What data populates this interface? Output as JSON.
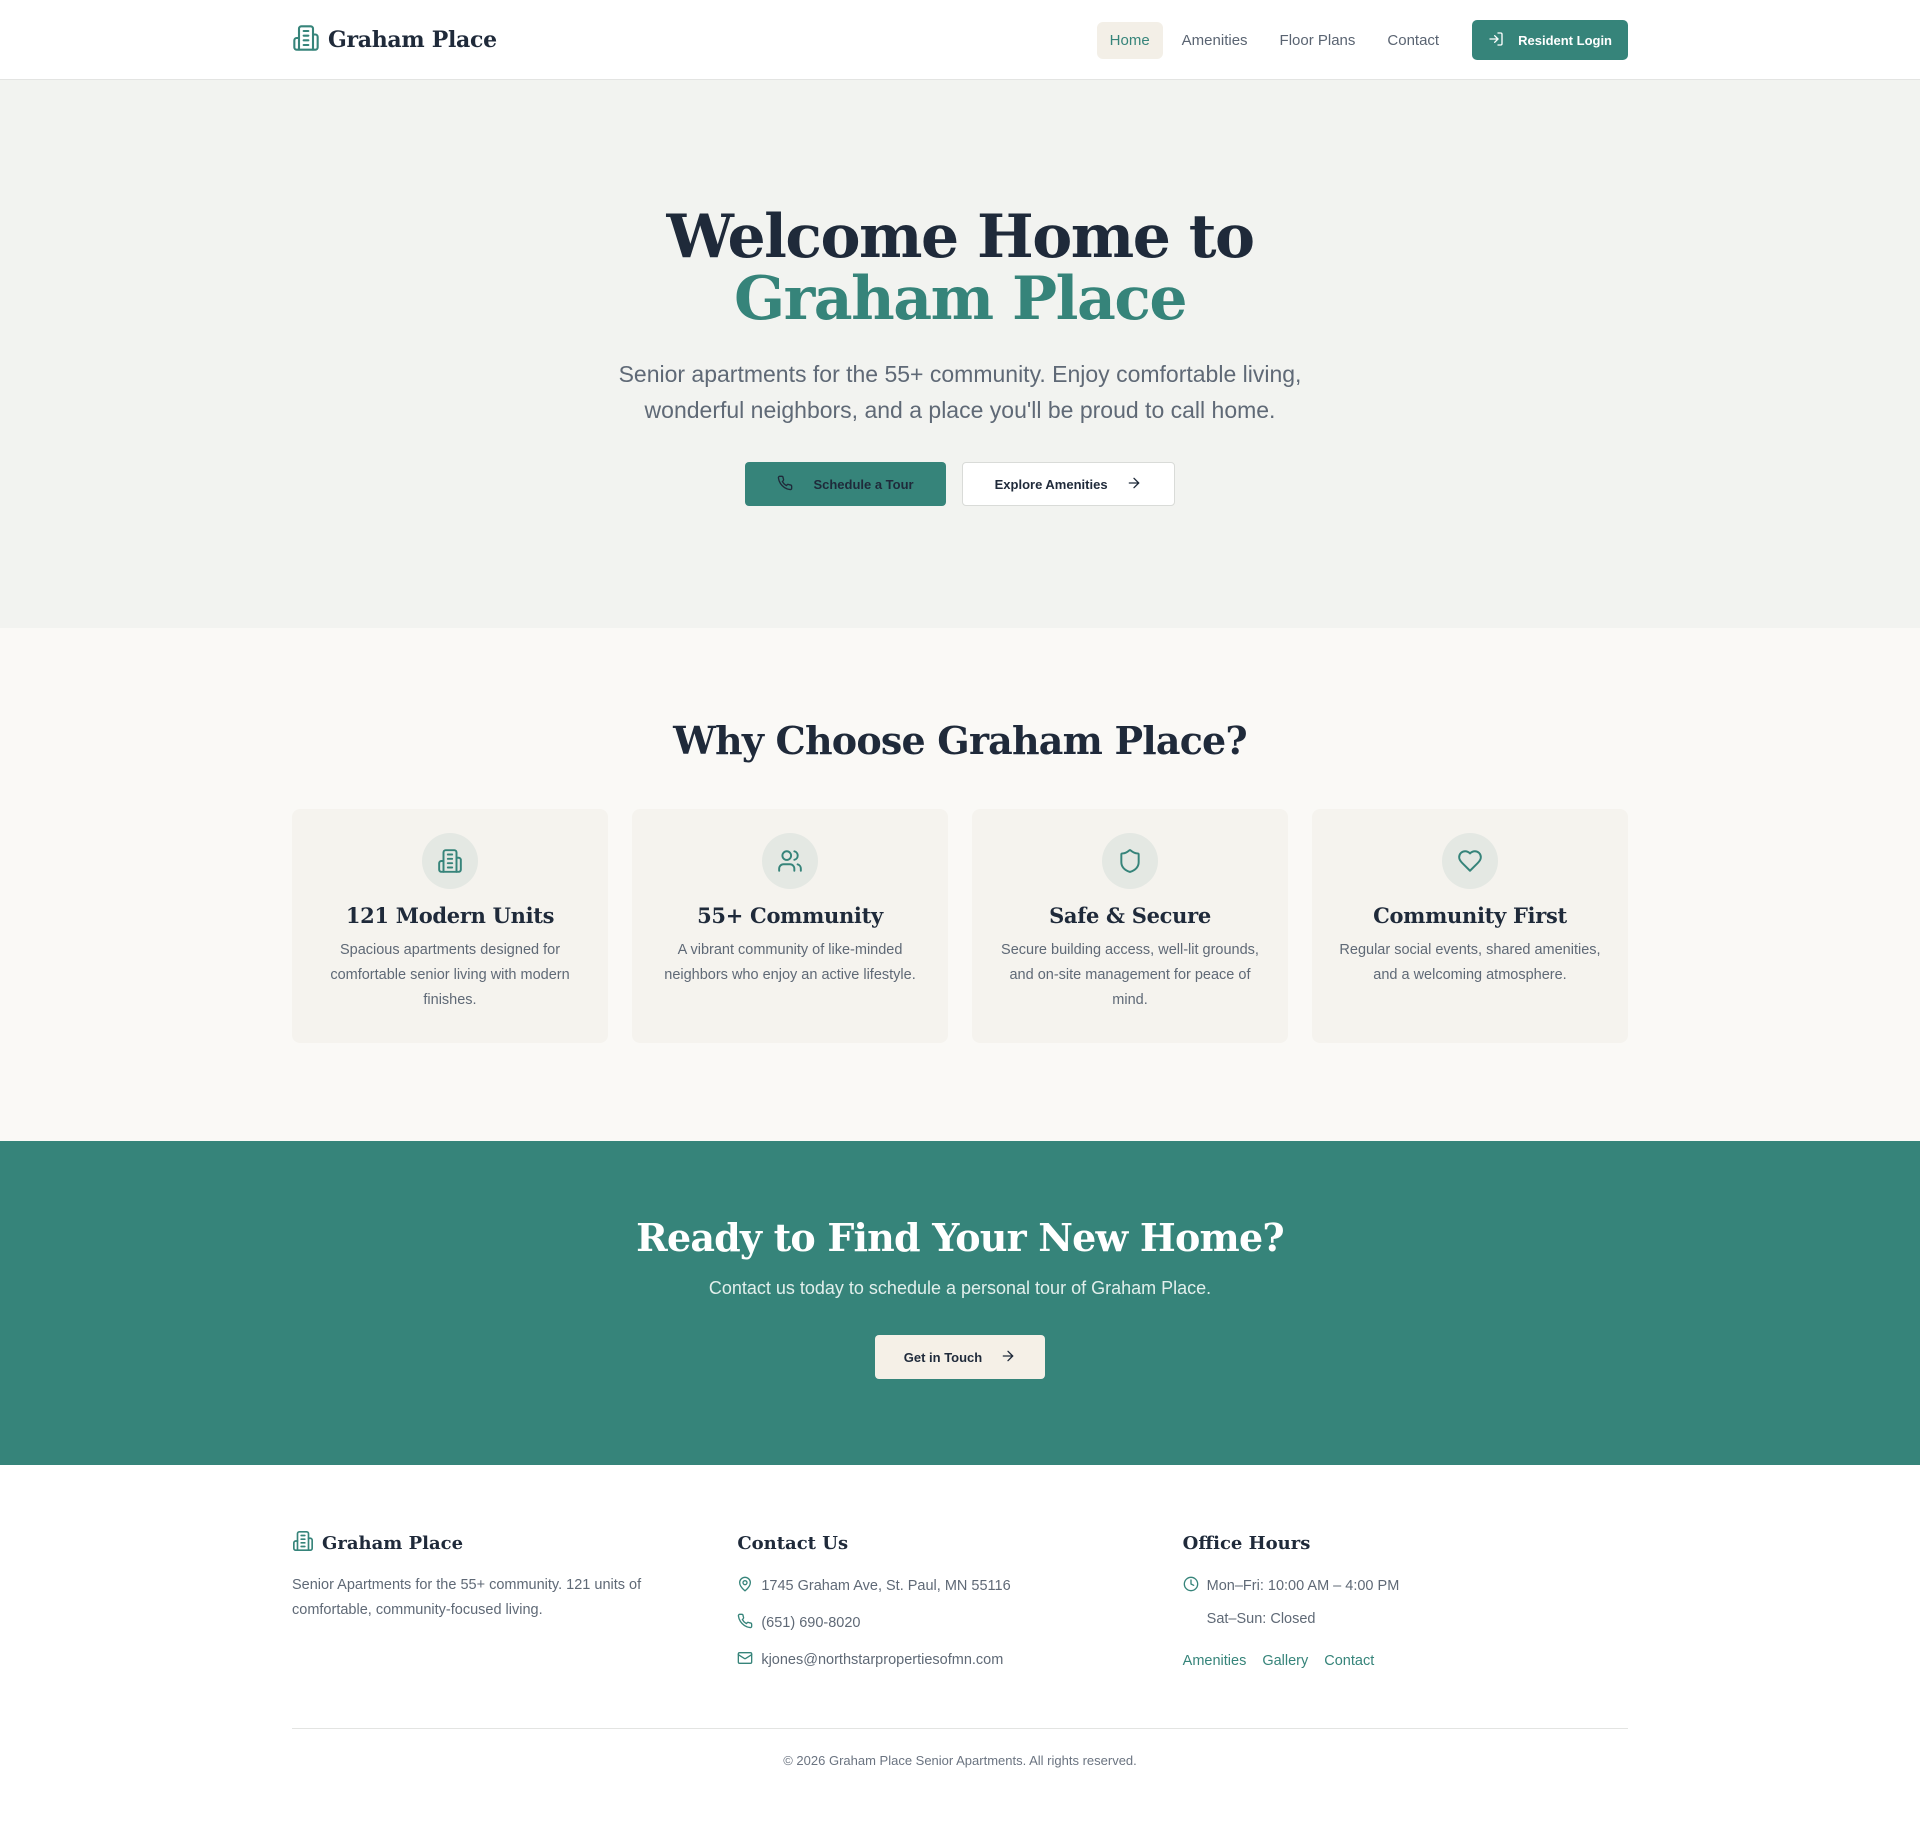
{
  "header": {
    "brand_name": "Graham Place",
    "nav": [
      {
        "label": "Home",
        "active": true
      },
      {
        "label": "Amenities",
        "active": false
      },
      {
        "label": "Floor Plans",
        "active": false
      },
      {
        "label": "Contact",
        "active": false
      }
    ],
    "login_label": "Resident Login"
  },
  "hero": {
    "title_line1": "Welcome Home to",
    "title_line2": "Graham Place",
    "subtitle": "Senior apartments for the 55+ community. Enjoy comfortable living, wonderful neighbors, and a place you'll be proud to call home.",
    "primary_cta": "Schedule a Tour",
    "secondary_cta": "Explore Amenities"
  },
  "features": {
    "title": "Why Choose Graham Place?",
    "cards": [
      {
        "icon": "building-icon",
        "title": "121 Modern Units",
        "desc": "Spacious apartments designed for comfortable senior living with modern finishes."
      },
      {
        "icon": "users-icon",
        "title": "55+ Community",
        "desc": "A vibrant community of like-minded neighbors who enjoy an active lifestyle."
      },
      {
        "icon": "shield-icon",
        "title": "Safe & Secure",
        "desc": "Secure building access, well-lit grounds, and on-site management for peace of mind."
      },
      {
        "icon": "heart-icon",
        "title": "Community First",
        "desc": "Regular social events, shared amenities, and a welcoming atmosphere."
      }
    ]
  },
  "cta": {
    "title": "Ready to Find Your New Home?",
    "subtitle": "Contact us today to schedule a personal tour of Graham Place.",
    "button": "Get in Touch"
  },
  "footer": {
    "brand_name": "Graham Place",
    "about": "Senior Apartments for the 55+ community. 121 units of comfortable, community-focused living.",
    "contact_heading": "Contact Us",
    "address": "1745 Graham Ave, St. Paul, MN 55116",
    "phone": "(651) 690-8020",
    "email": "kjones@northstarpropertiesofmn.com",
    "hours_heading": "Office Hours",
    "hours_weekday": "Mon–Fri: 10:00 AM – 4:00 PM",
    "hours_weekend": "Sat–Sun: Closed",
    "links": [
      "Amenities",
      "Gallery",
      "Contact"
    ],
    "copyright": "© 2026 Graham Place Senior Apartments. All rights reserved."
  },
  "colors": {
    "accent": "#36847a",
    "dark_text": "#1f2a3a",
    "muted_text": "#5f6976",
    "hero_bg": "#f2f3f0",
    "section_bg": "#faf9f6",
    "card_bg": "#f5f3ee",
    "cta_button_bg": "#f5f0e7"
  }
}
